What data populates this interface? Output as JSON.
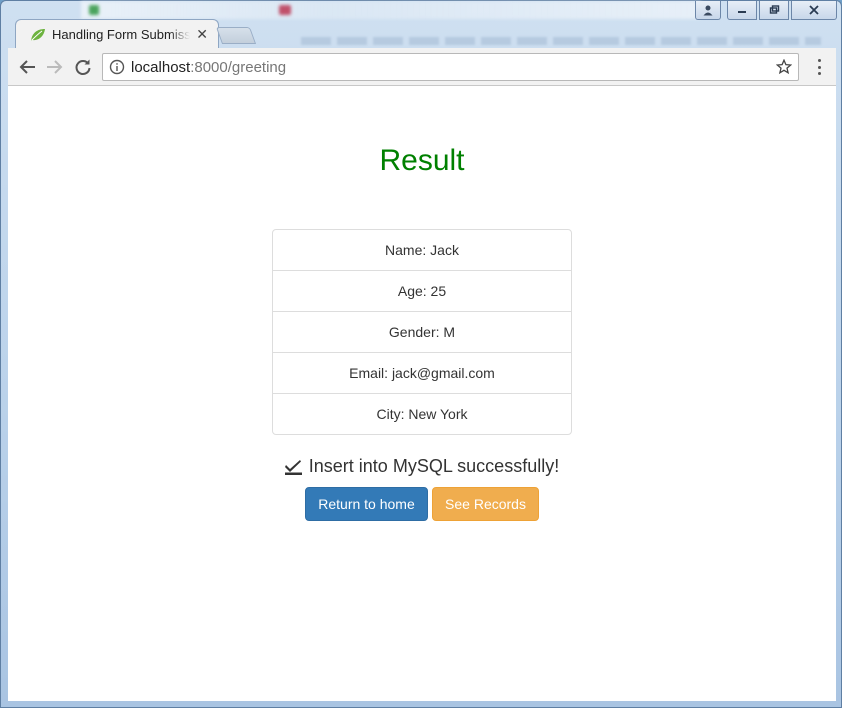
{
  "browser": {
    "tab_title": "Handling Form Submission",
    "url_host": "localhost",
    "url_rest": ":8000/greeting"
  },
  "page": {
    "title": "Result",
    "details": [
      {
        "label": "Name: Jack"
      },
      {
        "label": "Age: 25"
      },
      {
        "label": "Gender: M"
      },
      {
        "label": "Email: jack@gmail.com"
      },
      {
        "label": "City: New York"
      }
    ],
    "status": "Insert into MySQL successfully!",
    "return_home_label": "Return to home",
    "see_records_label": "See Records"
  },
  "colors": {
    "title": "#008000",
    "primary": "#337ab7",
    "warning": "#f0ad4e"
  },
  "icons": {
    "tab": "leaf-icon",
    "status": "check-square-icon"
  }
}
